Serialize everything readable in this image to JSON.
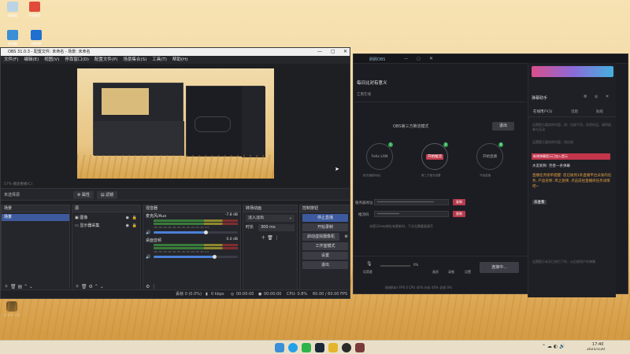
{
  "desktop": {
    "icons": [
      {
        "label": "回收站"
      },
      {
        "label": "手机助手"
      },
      {
        "label": "此电脑"
      },
      {
        "label": "快剪辑"
      }
    ],
    "bottom_icon_label": "剪映专业版"
  },
  "stream_app": {
    "tab_label": "刷刷OBS",
    "title_fragment": "每日比对有意义",
    "sub_fragment": "江南在线",
    "mode_label": "OBS第三方推流模式",
    "exit_btn": "退出",
    "step1": "Felix LAN",
    "step2": "开始推流",
    "step3": "开始直播",
    "step1_caption": "推流/播放地址",
    "step2_caption": "第三方推流设置",
    "step3_caption": "开始直播",
    "server_label": "服务器地址",
    "server_value": "************************************",
    "key_label": "推流码",
    "key_value": "**************",
    "copy_label": "复制",
    "hint": "本提示hmp地址有更新时，下次无需重复填写",
    "mic_label": "话筒麦",
    "mic_value": "0%",
    "tool_labels": [
      "画质",
      "录制",
      "设置"
    ],
    "connect_btn": "连接中...",
    "status": "网络Kb/s  FPS 0  CPU 40%  内存 40%  丢帧 0%"
  },
  "chat": {
    "header": "弹幕助手",
    "tabs": [
      "在线用户(1)",
      "话题",
      "贴纸"
    ],
    "lines": [
      "运营提示喜欢的内容，如：比较干货，优质作品，请积极参与互动",
      "运营提示喜欢的内容，如比较",
      "新增的弹幕已经加入提示"
    ],
    "warn": "新增弹幕提示已加入提示",
    "user_msg": "水友昵称: 完善一条弹幕",
    "task": "直播任务接单提醒: 您已收到1条直播平台派发的任务, 产品名称: 风之旋律, 点击前往直播商任务详情吧~",
    "task_link": "去查看",
    "footer": "运营提示本次已进行了你，以后按用户的弹幕"
  },
  "obs": {
    "title": "OBS 31.0.3 - 配置文件: 未命名 - 场景: 未命名",
    "menu": [
      "文件(F)",
      "编辑(E)",
      "视图(V)",
      "停靠窗口(D)",
      "配置文件(P)",
      "场景集合(S)",
      "工具(T)",
      "帮助(H)"
    ],
    "preview_caption": "57%  播放重播(C)",
    "no_source": "未选择源",
    "props_btn": "属性",
    "filters_btn": "滤镜",
    "docks": {
      "scenes": "场景",
      "sources": "源",
      "mixer": "混音器",
      "transitions": "转场动画",
      "controls": "控制按钮"
    },
    "scene_item": "场景",
    "source_items": [
      "图像",
      "显示器采集"
    ],
    "mixer_tracks": [
      {
        "name": "麦克风/Aux",
        "db": "-7.8 dB",
        "level": 0.62
      },
      {
        "name": "桌面音频",
        "db": "0.0 dB",
        "level": 0.72
      }
    ],
    "meter_ticks": "-60 -55 -50 -45 -40 -35 -30 -25 -20 -15 -10 -5 0",
    "transition_type": "淡入淡出",
    "duration_label": "时长",
    "duration_value": "300 ms",
    "control_buttons": [
      "停止直播",
      "开始录制",
      "启动虚拟摄像机",
      "工作室模式",
      "设置",
      "退出"
    ],
    "status": {
      "dropped": "丢帧 0 (0.0%)",
      "kbps": "0 kbps",
      "stream_time": "00:00:00",
      "rec_time": "00:00:00",
      "cpu": "CPU: 0.8%",
      "fps": "60.00 / 60.00 FPS"
    }
  },
  "taskbar": {
    "time": "17:40",
    "date": "2025/1/20"
  }
}
